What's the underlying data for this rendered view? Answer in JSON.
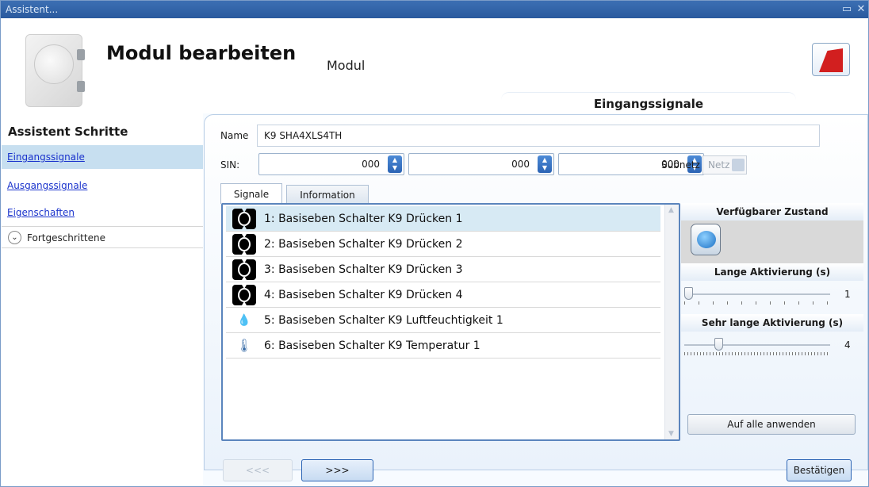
{
  "window": {
    "title": "Assistent..."
  },
  "header": {
    "title": "Modul bearbeiten",
    "subtitle": "Modul",
    "section_tab": "Eingangssignale"
  },
  "sidebar": {
    "title": "Assistent Schritte",
    "items": [
      {
        "label": "Eingangssignale",
        "active": true
      },
      {
        "label": "Ausgangssignale",
        "active": false
      },
      {
        "label": "Eigenschaften",
        "active": false
      }
    ],
    "advanced": {
      "label": "Fortgeschrittene",
      "icon": "chevron-down-circle-icon"
    }
  },
  "form": {
    "name_label": "Name",
    "name_value": "K9 SHA4XLS4TH",
    "sin_label": "SIN:",
    "sin_values": [
      "000",
      "000",
      "000"
    ],
    "subnetz_label": "Subnetz",
    "subnetz_value": "Netz 1"
  },
  "tabs": [
    {
      "label": "Signale",
      "selected": true
    },
    {
      "label": "Information",
      "selected": false
    }
  ],
  "signals": [
    {
      "label": "1: Basiseben Schalter K9 Drücken 1",
      "icon": "push-button-icon",
      "selected": true
    },
    {
      "label": "2: Basiseben Schalter K9 Drücken 2",
      "icon": "push-button-icon",
      "selected": false
    },
    {
      "label": "3: Basiseben Schalter K9 Drücken 3",
      "icon": "push-button-icon",
      "selected": false
    },
    {
      "label": "4: Basiseben Schalter K9 Drücken 4",
      "icon": "push-button-icon",
      "selected": false
    },
    {
      "label": "5: Basiseben Schalter K9 Luftfeuchtigkeit 1",
      "icon": "humidity-icon",
      "selected": false
    },
    {
      "label": "6: Basiseben Schalter K9 Temperatur 1",
      "icon": "thermometer-icon",
      "selected": false
    }
  ],
  "right_panel": {
    "available_state_label": "Verfügbarer Zustand",
    "long_activation_label": "Lange Aktivierung (s)",
    "long_activation_value": "1",
    "very_long_activation_label": "Sehr lange Aktivierung (s)",
    "very_long_activation_value": "4",
    "apply_all_label": "Auf alle anwenden"
  },
  "footer": {
    "prev_label": "<<<",
    "next_label": ">>>",
    "confirm_label": "Bestätigen"
  },
  "colors": {
    "titlebar": "#2a5a9e",
    "selection": "#d7eaf4",
    "link": "#1a33cc",
    "accent_button": "#2e66b5"
  }
}
